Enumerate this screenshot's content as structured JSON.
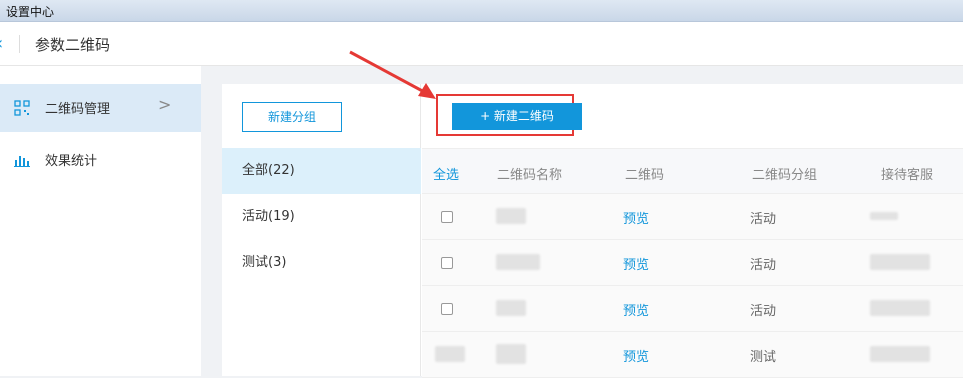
{
  "window": {
    "title": "设置中心"
  },
  "header": {
    "title": "参数二维码"
  },
  "sidebar": {
    "items": [
      {
        "label": "二维码管理",
        "icon": "qr-code-icon",
        "active": true
      },
      {
        "label": "效果统计",
        "icon": "bar-chart-icon",
        "active": false
      }
    ]
  },
  "groups": {
    "new_button": "新建分组",
    "items": [
      {
        "label": "全部(22)",
        "active": true
      },
      {
        "label": "活动(19)",
        "active": false
      },
      {
        "label": "测试(3)",
        "active": false
      }
    ]
  },
  "toolbar": {
    "new_qr_button": "+ 新建二维码"
  },
  "table": {
    "headers": [
      "全选",
      "二维码名称",
      "二维码",
      "二维码分组",
      "接待客服"
    ],
    "rows": [
      {
        "preview": "预览",
        "group": "活动"
      },
      {
        "preview": "预览",
        "group": "活动"
      },
      {
        "preview": "预览",
        "group": "活动"
      },
      {
        "preview": "预览",
        "group": "测试"
      }
    ]
  },
  "colors": {
    "accent": "#1296db",
    "highlight": "#e53935",
    "active_bg": "#dcf0fb"
  }
}
